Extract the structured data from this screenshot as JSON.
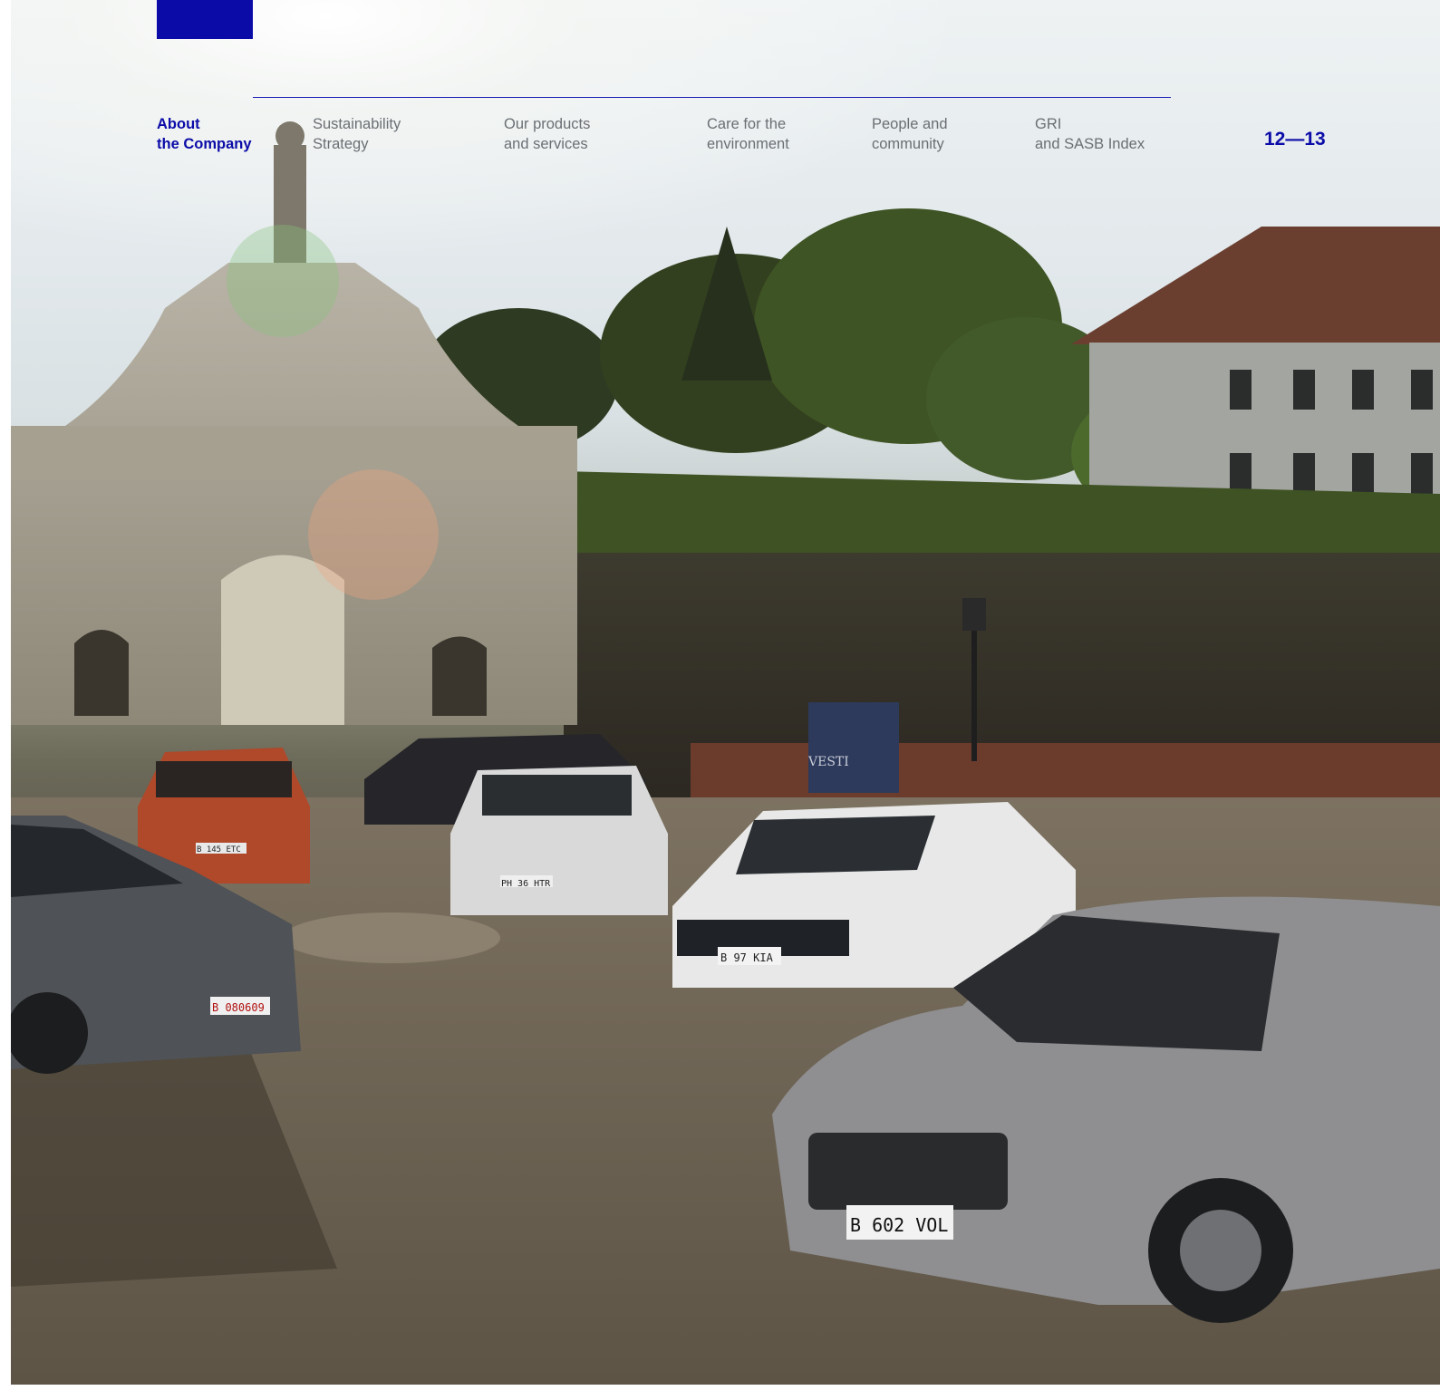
{
  "nav": {
    "items": [
      {
        "line1": "About",
        "line2": "the Company",
        "active": true
      },
      {
        "line1": "Sustainability",
        "line2": "Strategy",
        "active": false
      },
      {
        "line1": "Our products",
        "line2": "and services",
        "active": false
      },
      {
        "line1": "Care for the",
        "line2": "environment",
        "active": false
      },
      {
        "line1": "People and",
        "line2": "community",
        "active": false
      },
      {
        "line1": "GRI",
        "line2": "and SASB Index",
        "active": false
      }
    ]
  },
  "page_numbers": "12—13",
  "photo": {
    "plates": [
      "B 145 ETC",
      "PH 36 HTR",
      "B 97 KIA",
      "B 080609",
      "B 602 VOL"
    ],
    "sign_text": "VESTI"
  },
  "colors": {
    "brand_blue": "#0b0ca8",
    "nav_gray": "#6b6f74"
  }
}
